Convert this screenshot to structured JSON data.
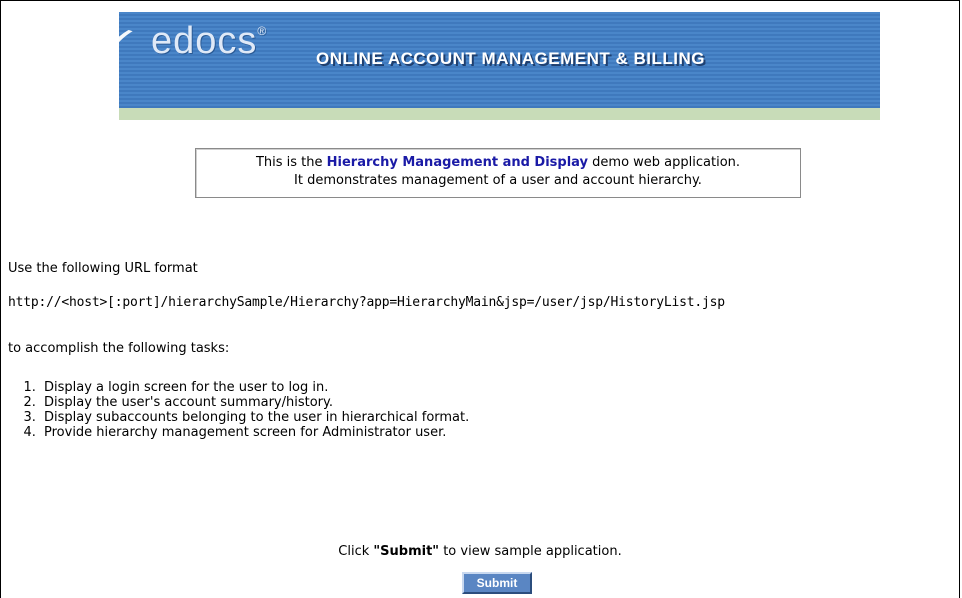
{
  "header": {
    "logo_text": "edocs",
    "logo_mark": "®",
    "banner_title": "ONLINE ACCOUNT MANAGEMENT & BILLING"
  },
  "intro": {
    "prefix": "This is the ",
    "highlight": "Hierarchy Management and Display",
    "suffix": " demo web application.",
    "line2": "It demonstrates management of a user and account hierarchy."
  },
  "main": {
    "url_intro": "Use the following URL format",
    "url_format": "http://<host>[:port]/hierarchySample/Hierarchy?app=HierarchyMain&jsp=/user/jsp/HistoryList.jsp",
    "tasks_intro": "to accomplish the following tasks:",
    "tasks": [
      "Display a login screen for the user to log in.",
      "Display the user's account summary/history.",
      "Display subaccounts belonging to the user in hierarchical format.",
      "Provide hierarchy management screen for Administrator user."
    ],
    "click_prefix": "Click ",
    "click_bold": "\"Submit\"",
    "click_suffix": " to view sample application."
  },
  "form": {
    "submit_label": "Submit"
  },
  "colors": {
    "banner_blue": "#4a86c9",
    "banner_strip": "#c8dcb8",
    "highlight": "#1a1aa6",
    "button": "#5a86c3"
  }
}
